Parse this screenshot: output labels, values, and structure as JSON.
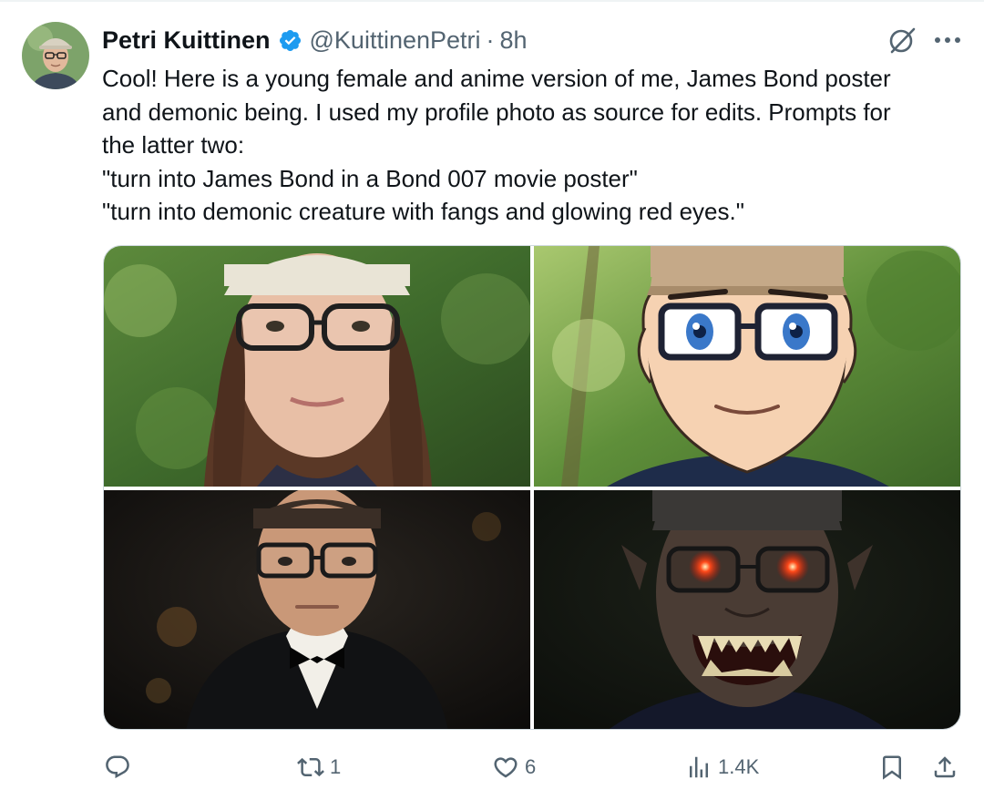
{
  "tweet": {
    "author_name": "Petri Kuittinen",
    "handle": "@KuittinenPetri",
    "separator": "·",
    "time": "8h",
    "text_lines": [
      "Cool! Here is a young female and anime version of me, James Bond poster",
      "and demonic being. I used my profile photo as source for edits. Prompts for",
      "the latter two:",
      "\"turn into James Bond in a Bond 007 movie poster\"",
      "\"turn into demonic creature with fangs and glowing red eyes.\""
    ]
  },
  "icons": {
    "verified": "verified-badge-icon",
    "grok": "grok-icon",
    "more": "more-icon",
    "reply": "reply-icon",
    "repost": "repost-icon",
    "like": "like-icon",
    "views": "views-icon",
    "bookmark": "bookmark-icon",
    "share": "share-icon"
  },
  "colors": {
    "verified_blue": "#1d9bf0",
    "text_primary": "#0f1419",
    "text_secondary": "#536471",
    "border": "#cfd9de"
  },
  "actions": {
    "reply_count": "",
    "repost_count": "1",
    "like_count": "6",
    "views_count": "1.4K"
  }
}
